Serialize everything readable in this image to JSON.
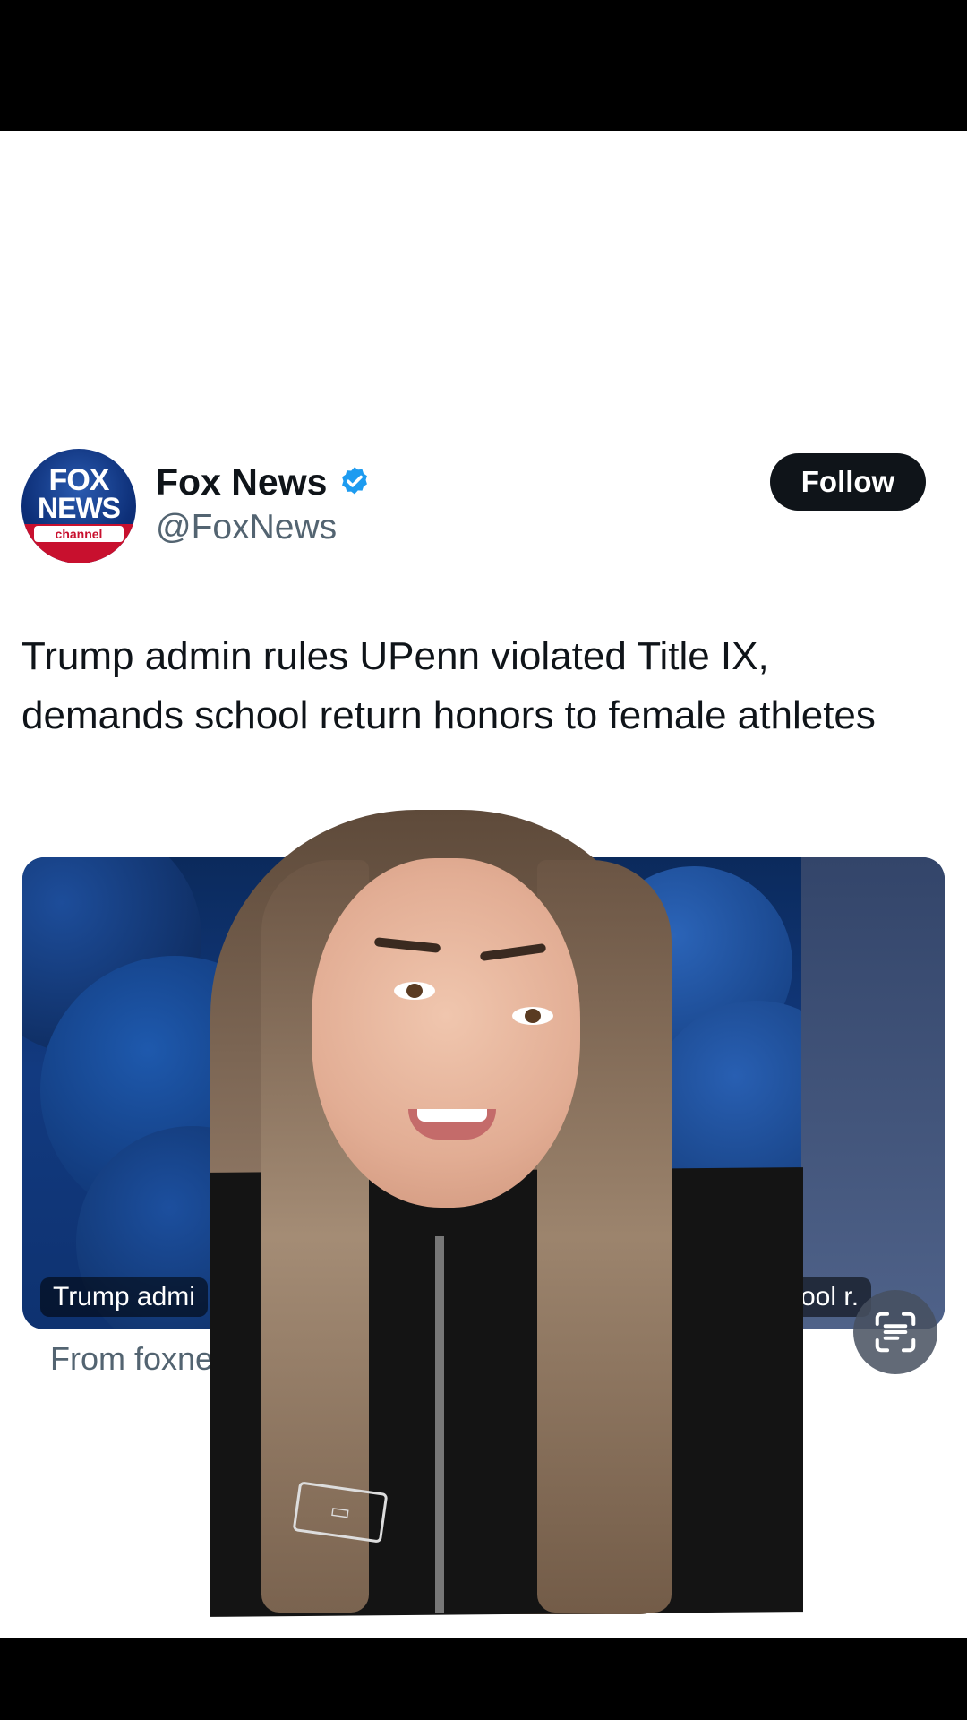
{
  "tweet": {
    "account": {
      "display_name": "Fox News",
      "handle": "@FoxNews",
      "verified": true,
      "avatar_logo_line1": "FOX",
      "avatar_logo_line2": "NEWS",
      "avatar_logo_line3": "channel"
    },
    "follow_label": "Follow",
    "text": "Trump admin rules UPenn violated Title IX, demands school return honors to female athletes",
    "card": {
      "caption_left": "Trump admi",
      "caption_right": "ool r.",
      "source": "From foxne"
    }
  },
  "icons": {
    "verified": "verified-badge-icon",
    "scan": "scan-text-icon"
  },
  "colors": {
    "follow_bg": "#0f1419",
    "verified_blue": "#1d9bf0",
    "handle_gray": "#536471"
  }
}
